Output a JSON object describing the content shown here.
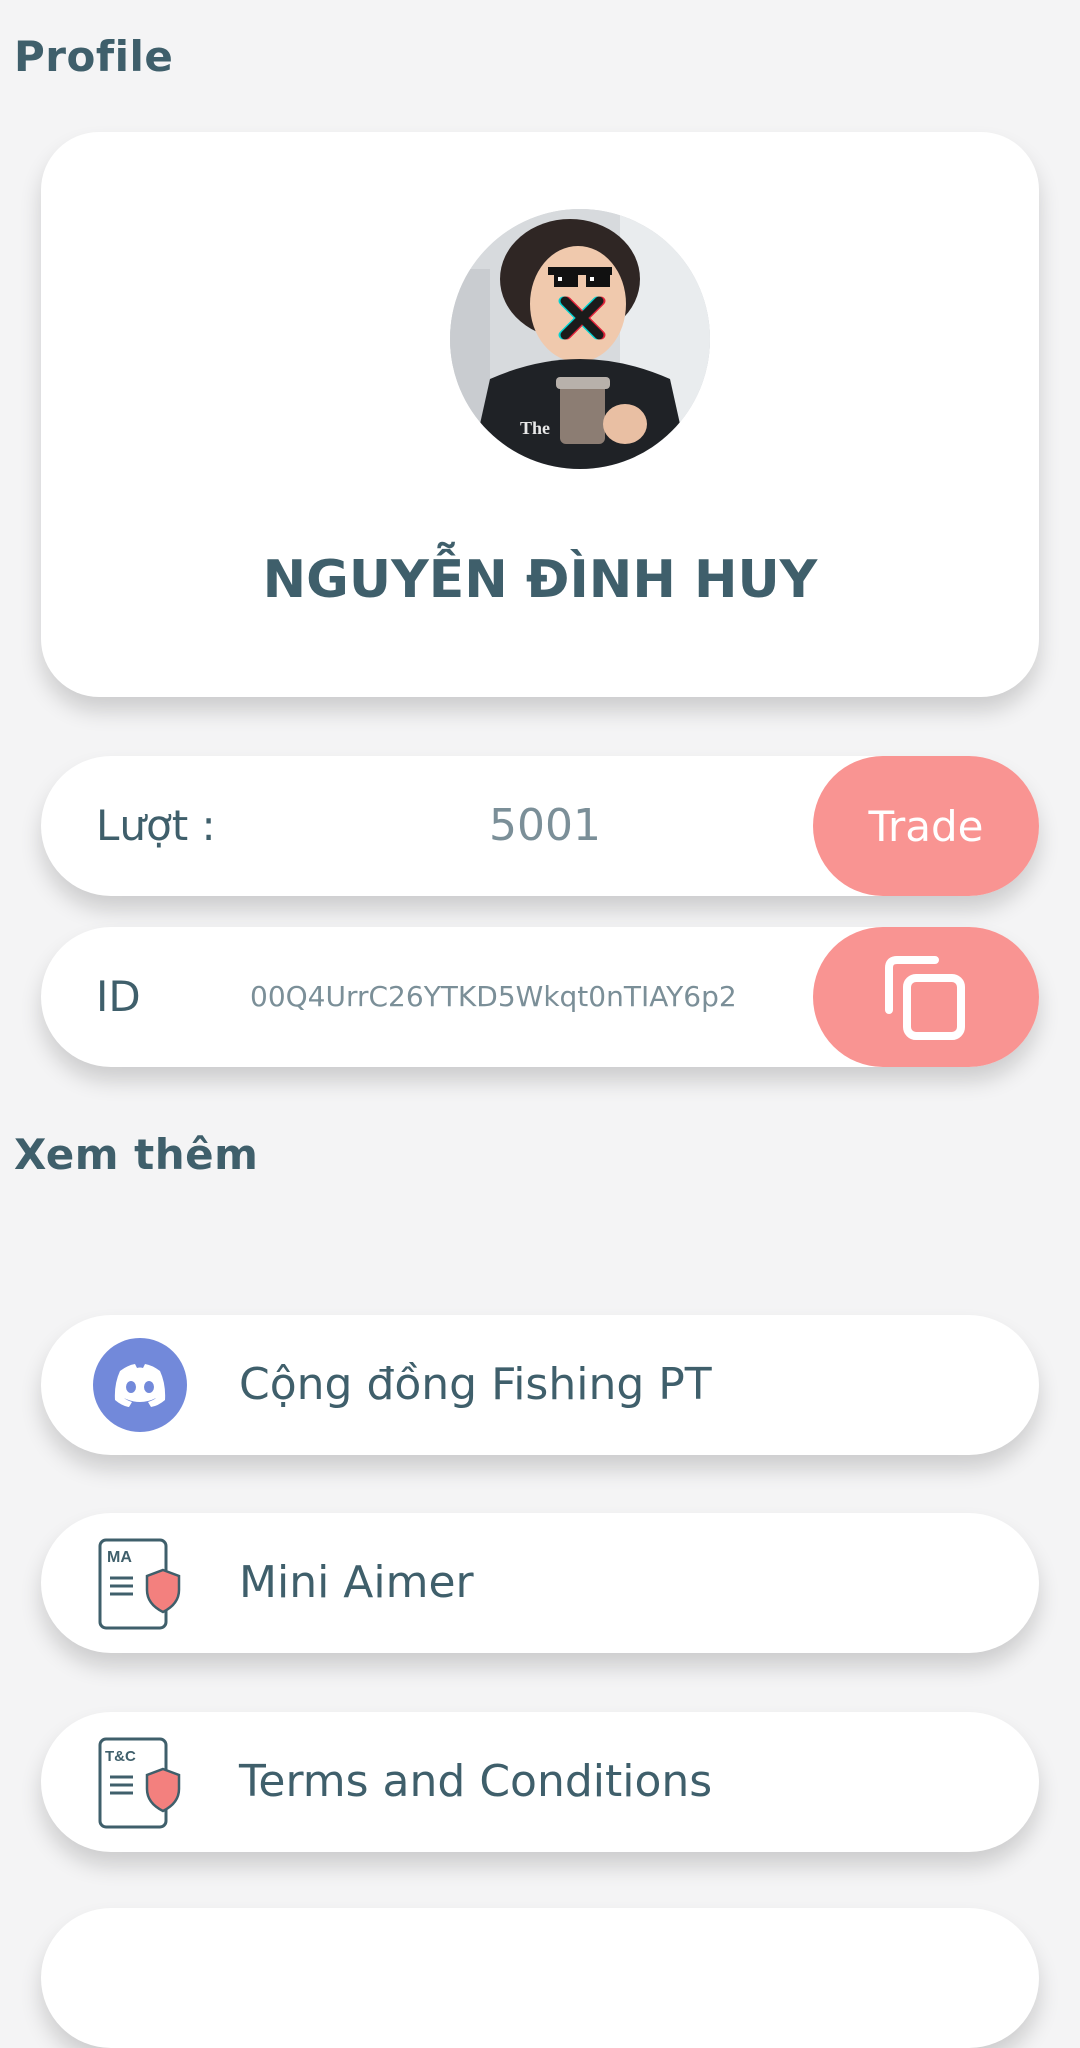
{
  "headers": {
    "profile": "Profile",
    "more": "Xem thêm"
  },
  "profile": {
    "name": "NGUYỄN ĐÌNH HUY"
  },
  "turns": {
    "label": "Lượt :",
    "value": "5001",
    "button_label": "Trade"
  },
  "id_row": {
    "label": "ID",
    "value": "00Q4UrrC26YTKD5Wkqt0nTIAY6p2",
    "copy_icon": "copy-icon"
  },
  "menu": {
    "items": [
      {
        "label": "Cộng đồng Fishing PT",
        "icon": "discord-icon"
      },
      {
        "label": "Mini Aimer",
        "icon": "document-shield-icon",
        "icon_text": "MA"
      },
      {
        "label": "Terms and Conditions",
        "icon": "document-shield-icon",
        "icon_text": "T&C"
      }
    ]
  },
  "colors": {
    "accent": "#f99492",
    "text": "#3f5f6b",
    "discord": "#7289da",
    "background": "#f4f4f5"
  }
}
